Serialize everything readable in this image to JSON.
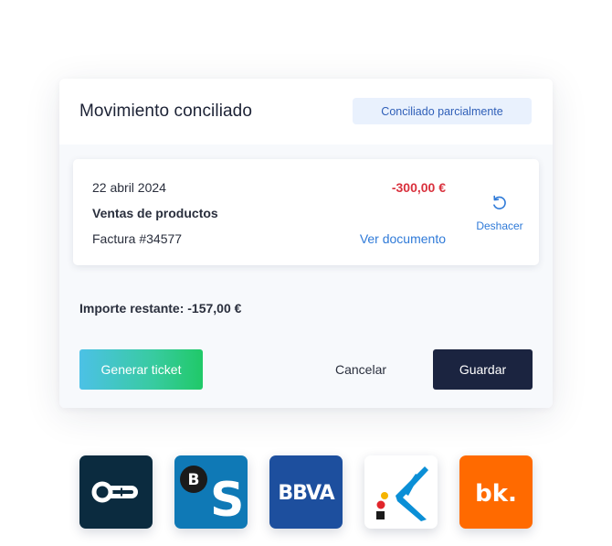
{
  "card": {
    "title": "Movimiento conciliado",
    "status_badge": "Conciliado parcialmente"
  },
  "movement": {
    "date": "22 abril 2024",
    "description": "Ventas de productos",
    "reference": "Factura  #34577",
    "amount": "-300,00 €",
    "view_document_label": "Ver documento",
    "undo_label": "Deshacer"
  },
  "remaining": "Importe restante: -157,00 €",
  "actions": {
    "generate_ticket_label": "Generar ticket",
    "cancel_label": "Cancelar",
    "save_label": "Guardar"
  },
  "banks": [
    {
      "icon": "openbank-logo-icon",
      "color": "#0b2b3f"
    },
    {
      "icon": "sabadell-logo-icon",
      "color": "#0f79b6"
    },
    {
      "icon": "bbva-logo-icon",
      "color": "#1d4f9e",
      "text": "BBVA"
    },
    {
      "icon": "caixabank-logo-icon",
      "color": "#ffffff"
    },
    {
      "icon": "bankinter-logo-icon",
      "color": "#ff6a00",
      "text": "bk."
    }
  ],
  "colors": {
    "accent_blue": "#2f7ad8",
    "negative_red": "#d9313d",
    "primary_dark": "#1b2440",
    "badge_bg": "#e9f1fd"
  }
}
